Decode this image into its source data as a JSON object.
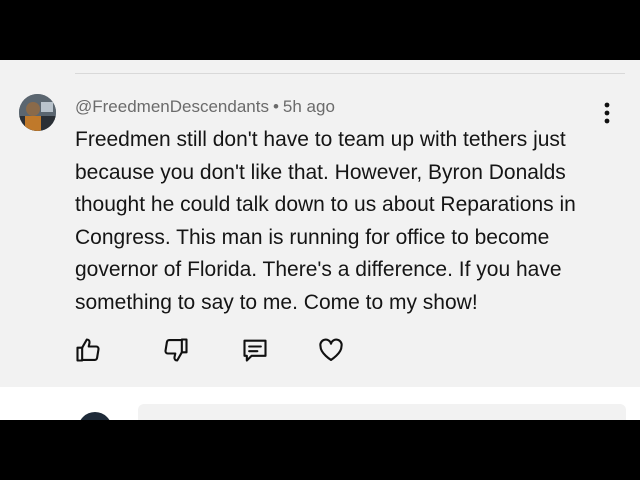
{
  "comment": {
    "author": "@FreedmenDescendants",
    "separator": "•",
    "timestamp": "5h ago",
    "body": "Freedmen still don't have to team up with tethers just because you don't like that. However, Byron Donalds thought he could talk down to us about Reparations in Congress. This man is running for office to become governor of Florida. There's a difference. If you have something to say to me. Come to my show!",
    "avatar_icon": "profile-photo-icon",
    "menu_icon": "more-vert-icon"
  },
  "actions": [
    {
      "name": "like",
      "icon": "thumbs-up-icon"
    },
    {
      "name": "dislike",
      "icon": "thumbs-down-icon"
    },
    {
      "name": "reply",
      "icon": "comment-icon"
    },
    {
      "name": "heart",
      "icon": "heart-icon"
    }
  ],
  "colors": {
    "card_background": "#f2f2f2",
    "meta_text": "#6b6b6b",
    "body_text": "#151515",
    "icon_stroke": "#111111",
    "letterbox": "#000000"
  }
}
